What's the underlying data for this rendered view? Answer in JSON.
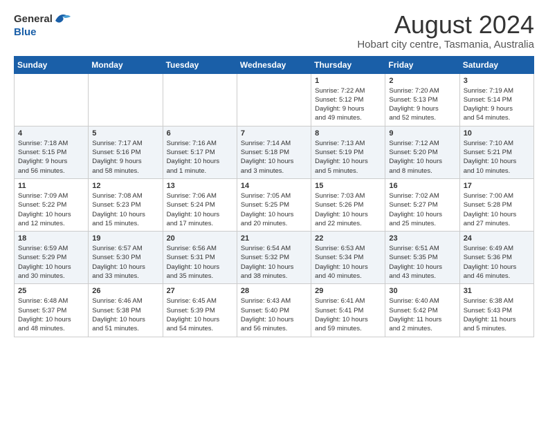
{
  "header": {
    "logo_general": "General",
    "logo_blue": "Blue",
    "month_title": "August 2024",
    "location": "Hobart city centre, Tasmania, Australia"
  },
  "days_of_week": [
    "Sunday",
    "Monday",
    "Tuesday",
    "Wednesday",
    "Thursday",
    "Friday",
    "Saturday"
  ],
  "weeks": [
    [
      {
        "day": "",
        "info": ""
      },
      {
        "day": "",
        "info": ""
      },
      {
        "day": "",
        "info": ""
      },
      {
        "day": "",
        "info": ""
      },
      {
        "day": "1",
        "info": "Sunrise: 7:22 AM\nSunset: 5:12 PM\nDaylight: 9 hours\nand 49 minutes."
      },
      {
        "day": "2",
        "info": "Sunrise: 7:20 AM\nSunset: 5:13 PM\nDaylight: 9 hours\nand 52 minutes."
      },
      {
        "day": "3",
        "info": "Sunrise: 7:19 AM\nSunset: 5:14 PM\nDaylight: 9 hours\nand 54 minutes."
      }
    ],
    [
      {
        "day": "4",
        "info": "Sunrise: 7:18 AM\nSunset: 5:15 PM\nDaylight: 9 hours\nand 56 minutes."
      },
      {
        "day": "5",
        "info": "Sunrise: 7:17 AM\nSunset: 5:16 PM\nDaylight: 9 hours\nand 58 minutes."
      },
      {
        "day": "6",
        "info": "Sunrise: 7:16 AM\nSunset: 5:17 PM\nDaylight: 10 hours\nand 1 minute."
      },
      {
        "day": "7",
        "info": "Sunrise: 7:14 AM\nSunset: 5:18 PM\nDaylight: 10 hours\nand 3 minutes."
      },
      {
        "day": "8",
        "info": "Sunrise: 7:13 AM\nSunset: 5:19 PM\nDaylight: 10 hours\nand 5 minutes."
      },
      {
        "day": "9",
        "info": "Sunrise: 7:12 AM\nSunset: 5:20 PM\nDaylight: 10 hours\nand 8 minutes."
      },
      {
        "day": "10",
        "info": "Sunrise: 7:10 AM\nSunset: 5:21 PM\nDaylight: 10 hours\nand 10 minutes."
      }
    ],
    [
      {
        "day": "11",
        "info": "Sunrise: 7:09 AM\nSunset: 5:22 PM\nDaylight: 10 hours\nand 12 minutes."
      },
      {
        "day": "12",
        "info": "Sunrise: 7:08 AM\nSunset: 5:23 PM\nDaylight: 10 hours\nand 15 minutes."
      },
      {
        "day": "13",
        "info": "Sunrise: 7:06 AM\nSunset: 5:24 PM\nDaylight: 10 hours\nand 17 minutes."
      },
      {
        "day": "14",
        "info": "Sunrise: 7:05 AM\nSunset: 5:25 PM\nDaylight: 10 hours\nand 20 minutes."
      },
      {
        "day": "15",
        "info": "Sunrise: 7:03 AM\nSunset: 5:26 PM\nDaylight: 10 hours\nand 22 minutes."
      },
      {
        "day": "16",
        "info": "Sunrise: 7:02 AM\nSunset: 5:27 PM\nDaylight: 10 hours\nand 25 minutes."
      },
      {
        "day": "17",
        "info": "Sunrise: 7:00 AM\nSunset: 5:28 PM\nDaylight: 10 hours\nand 27 minutes."
      }
    ],
    [
      {
        "day": "18",
        "info": "Sunrise: 6:59 AM\nSunset: 5:29 PM\nDaylight: 10 hours\nand 30 minutes."
      },
      {
        "day": "19",
        "info": "Sunrise: 6:57 AM\nSunset: 5:30 PM\nDaylight: 10 hours\nand 33 minutes."
      },
      {
        "day": "20",
        "info": "Sunrise: 6:56 AM\nSunset: 5:31 PM\nDaylight: 10 hours\nand 35 minutes."
      },
      {
        "day": "21",
        "info": "Sunrise: 6:54 AM\nSunset: 5:32 PM\nDaylight: 10 hours\nand 38 minutes."
      },
      {
        "day": "22",
        "info": "Sunrise: 6:53 AM\nSunset: 5:34 PM\nDaylight: 10 hours\nand 40 minutes."
      },
      {
        "day": "23",
        "info": "Sunrise: 6:51 AM\nSunset: 5:35 PM\nDaylight: 10 hours\nand 43 minutes."
      },
      {
        "day": "24",
        "info": "Sunrise: 6:49 AM\nSunset: 5:36 PM\nDaylight: 10 hours\nand 46 minutes."
      }
    ],
    [
      {
        "day": "25",
        "info": "Sunrise: 6:48 AM\nSunset: 5:37 PM\nDaylight: 10 hours\nand 48 minutes."
      },
      {
        "day": "26",
        "info": "Sunrise: 6:46 AM\nSunset: 5:38 PM\nDaylight: 10 hours\nand 51 minutes."
      },
      {
        "day": "27",
        "info": "Sunrise: 6:45 AM\nSunset: 5:39 PM\nDaylight: 10 hours\nand 54 minutes."
      },
      {
        "day": "28",
        "info": "Sunrise: 6:43 AM\nSunset: 5:40 PM\nDaylight: 10 hours\nand 56 minutes."
      },
      {
        "day": "29",
        "info": "Sunrise: 6:41 AM\nSunset: 5:41 PM\nDaylight: 10 hours\nand 59 minutes."
      },
      {
        "day": "30",
        "info": "Sunrise: 6:40 AM\nSunset: 5:42 PM\nDaylight: 11 hours\nand 2 minutes."
      },
      {
        "day": "31",
        "info": "Sunrise: 6:38 AM\nSunset: 5:43 PM\nDaylight: 11 hours\nand 5 minutes."
      }
    ]
  ]
}
